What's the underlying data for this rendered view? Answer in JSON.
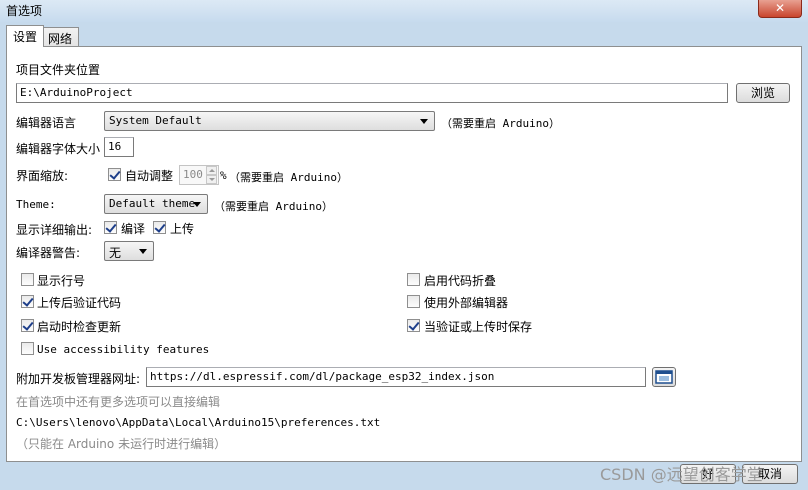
{
  "window": {
    "title": "首选项",
    "close_label": "✕"
  },
  "tabs": [
    {
      "label": "设置"
    },
    {
      "label": "网络"
    }
  ],
  "settings": {
    "sketchbook_label": "项目文件夹位置",
    "sketchbook_path": "E:\\ArduinoProject",
    "browse_label": "浏览",
    "editor_language_label": "编辑器语言",
    "editor_language_value": "System Default",
    "restart_note": "（需要重启 Arduino）",
    "font_size_label": "编辑器字体大小",
    "font_size_value": "16",
    "scale_label": "界面缩放:",
    "auto_scale_label": "自动调整",
    "scale_value": "100",
    "scale_unit": "%",
    "theme_label": "Theme:",
    "theme_value": "Default theme",
    "verbose_label": "显示详细输出:",
    "verbose_compile_label": "编译",
    "verbose_upload_label": "上传",
    "warnings_label": "编译器警告:",
    "warnings_value": "无",
    "show_line_numbers": "显示行号",
    "enable_code_folding": "启用代码折叠",
    "verify_after_upload": "上传后验证代码",
    "use_external_editor": "使用外部编辑器",
    "check_updates": "启动时检查更新",
    "save_on_verify": "当验证或上传时保存",
    "accessibility": "Use accessibility features",
    "board_urls_label": "附加开发板管理器网址:",
    "board_urls_value": "https://dl.espressif.com/dl/package_esp32_index.json",
    "more_prefs_note": "在首选项中还有更多选项可以直接编辑",
    "prefs_path": "C:\\Users\\lenovo\\AppData\\Local\\Arduino15\\preferences.txt",
    "edit_note": "（只能在 Arduino 未运行时进行编辑）"
  },
  "footer": {
    "ok_label": "好",
    "cancel_label": "取消",
    "watermark": "CSDN @远望创客学堂"
  }
}
